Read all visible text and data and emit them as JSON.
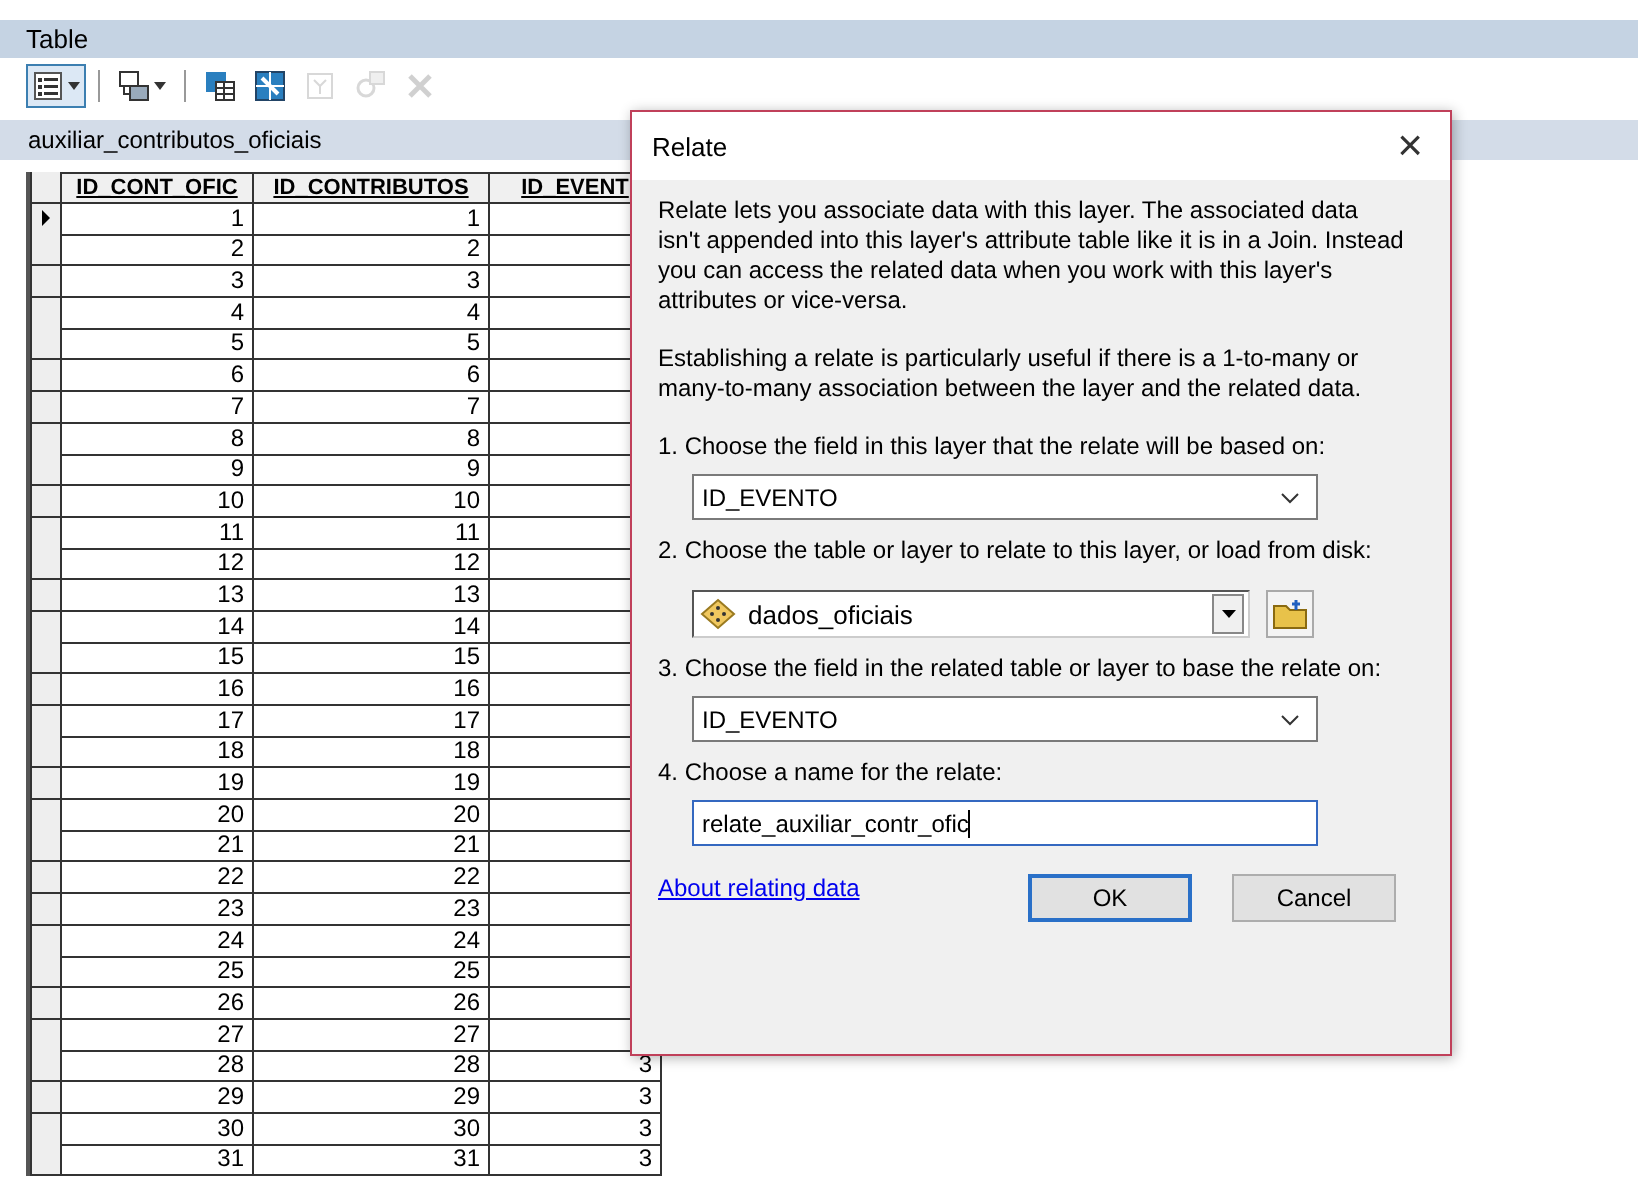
{
  "window": {
    "title": "Table"
  },
  "toolbar": [
    {
      "kind": "table-options",
      "selected": true,
      "disabled": false
    },
    {
      "kind": "related-tables",
      "selected": false,
      "disabled": false
    },
    {
      "kind": "select-by-attributes",
      "selected": false,
      "disabled": false
    },
    {
      "kind": "switch-selection",
      "selected": false,
      "disabled": false
    },
    {
      "kind": "clear-selection",
      "selected": false,
      "disabled": true
    },
    {
      "kind": "zoom-to-selected",
      "selected": false,
      "disabled": true
    },
    {
      "kind": "delete-selected",
      "selected": false,
      "disabled": true
    }
  ],
  "table": {
    "name": "auxiliar_contributos_oficiais",
    "columns": [
      "ID_CONT_OFIC",
      "ID_CONTRIBUTOS",
      "ID_EVENT"
    ],
    "rows": [
      {
        "current": true,
        "cells": [
          "1",
          "1"
        ]
      },
      {
        "current": false,
        "cells": [
          "2",
          "2"
        ]
      },
      {
        "current": false,
        "cells": [
          "3",
          "3"
        ]
      },
      {
        "current": false,
        "cells": [
          "4",
          "4"
        ]
      },
      {
        "current": false,
        "cells": [
          "5",
          "5"
        ]
      },
      {
        "current": false,
        "cells": [
          "6",
          "6"
        ]
      },
      {
        "current": false,
        "cells": [
          "7",
          "7"
        ]
      },
      {
        "current": false,
        "cells": [
          "8",
          "8"
        ]
      },
      {
        "current": false,
        "cells": [
          "9",
          "9"
        ]
      },
      {
        "current": false,
        "cells": [
          "10",
          "10"
        ]
      },
      {
        "current": false,
        "cells": [
          "11",
          "11"
        ]
      },
      {
        "current": false,
        "cells": [
          "12",
          "12"
        ]
      },
      {
        "current": false,
        "cells": [
          "13",
          "13"
        ]
      },
      {
        "current": false,
        "cells": [
          "14",
          "14"
        ]
      },
      {
        "current": false,
        "cells": [
          "15",
          "15"
        ]
      },
      {
        "current": false,
        "cells": [
          "16",
          "16"
        ]
      },
      {
        "current": false,
        "cells": [
          "17",
          "17"
        ]
      },
      {
        "current": false,
        "cells": [
          "18",
          "18"
        ]
      },
      {
        "current": false,
        "cells": [
          "19",
          "19"
        ]
      },
      {
        "current": false,
        "cells": [
          "20",
          "20"
        ]
      },
      {
        "current": false,
        "cells": [
          "21",
          "21"
        ]
      },
      {
        "current": false,
        "cells": [
          "22",
          "22"
        ]
      },
      {
        "current": false,
        "cells": [
          "23",
          "23"
        ]
      },
      {
        "current": false,
        "cells": [
          "24",
          "24"
        ]
      },
      {
        "current": false,
        "cells": [
          "25",
          "25"
        ]
      },
      {
        "current": false,
        "cells": [
          "26",
          "26"
        ]
      },
      {
        "current": false,
        "cells": [
          "27",
          "27"
        ]
      },
      {
        "current": false,
        "cells": [
          "28",
          "28",
          "3"
        ]
      },
      {
        "current": false,
        "cells": [
          "29",
          "29",
          "3"
        ]
      },
      {
        "current": false,
        "cells": [
          "30",
          "30",
          "3"
        ]
      },
      {
        "current": false,
        "cells": [
          "31",
          "31",
          "3"
        ]
      }
    ]
  },
  "dialog": {
    "title": "Relate",
    "close": "×",
    "paragraphs": [
      "Relate lets you associate data with this layer. The associated data isn't appended into this layer's attribute table like it is in a Join. Instead you can access the related data when you work with this layer's attributes or vice-versa.",
      "Establishing a relate is particularly useful if there is a 1-to-many or many-to-many association between the layer and the related data."
    ],
    "steps": [
      {
        "kind": "dropdown",
        "label": "1. Choose the field in this layer that the relate will be based on:",
        "value": "ID_EVENTO"
      },
      {
        "kind": "table-picker",
        "label": "2. Choose the table or layer to relate to this layer, or load from disk:",
        "value": "dados_oficiais"
      },
      {
        "kind": "dropdown",
        "label": "3. Choose the field in the related table or layer to base the relate on:",
        "value": "ID_EVENTO"
      },
      {
        "kind": "text",
        "label": "4. Choose a name for the relate:",
        "value": "relate_auxiliar_contr_ofic"
      }
    ],
    "link": "About relating data",
    "ok": "OK",
    "cancel": "Cancel"
  }
}
